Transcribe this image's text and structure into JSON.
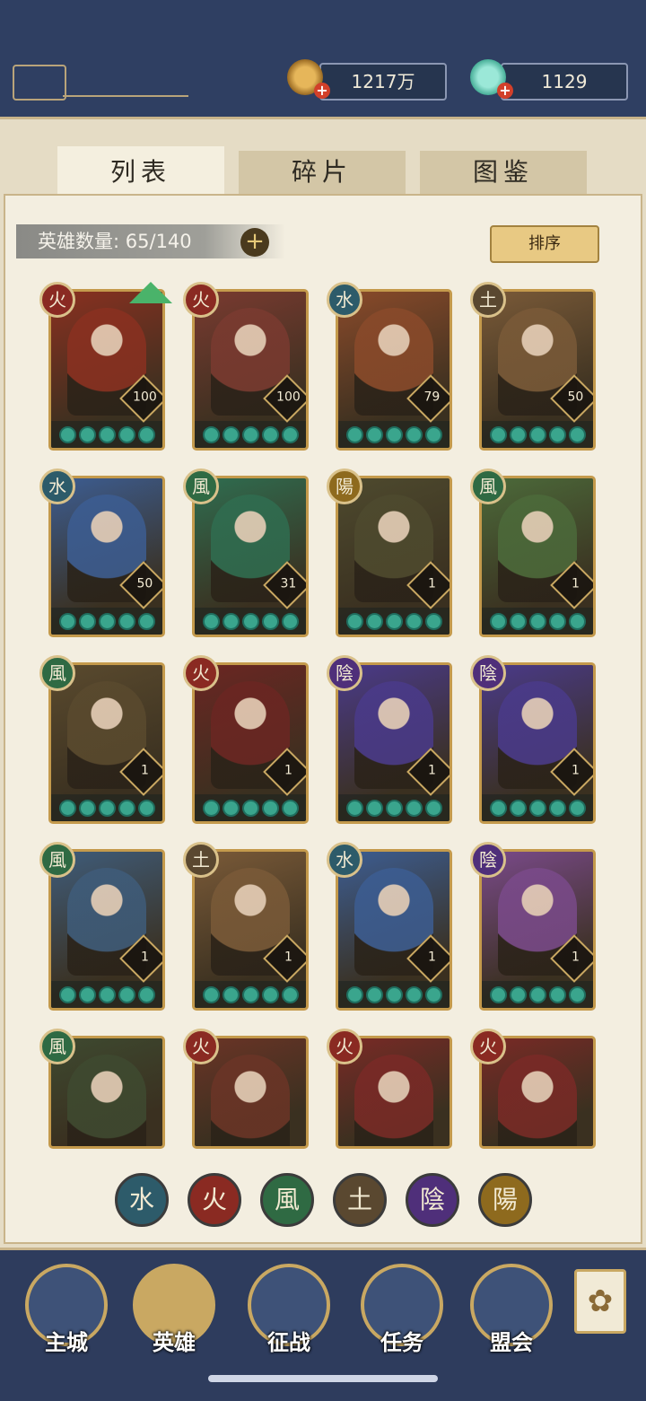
{
  "resources": {
    "coins": "1217万",
    "gems": "1129",
    "coin_icon": "coin-icon",
    "gem_icon": "jade-icon"
  },
  "tabs": [
    {
      "label": "列表",
      "active": true
    },
    {
      "label": "碎片",
      "active": false
    },
    {
      "label": "图鉴",
      "active": false
    }
  ],
  "hero_count": {
    "label": "英雄数量:",
    "value": "65/140"
  },
  "sort_label": "排序",
  "elements": {
    "water": {
      "glyph": "水",
      "color": "#2d5b6a"
    },
    "fire": {
      "glyph": "火",
      "color": "#8a2a22"
    },
    "wind": {
      "glyph": "風",
      "color": "#2f6a43"
    },
    "earth": {
      "glyph": "土",
      "color": "#5a4830"
    },
    "yin": {
      "glyph": "陰",
      "color": "#4f2f7a"
    },
    "yang": {
      "glyph": "陽",
      "color": "#8e6a1e"
    }
  },
  "heroes": [
    {
      "element": "fire",
      "level": "100",
      "bg": "#8a3020",
      "upgrade": true
    },
    {
      "element": "fire",
      "level": "100",
      "bg": "#7a3a30"
    },
    {
      "element": "water",
      "level": "79",
      "bg": "#8a4a2a"
    },
    {
      "element": "earth",
      "level": "50",
      "bg": "#7a5a38"
    },
    {
      "element": "water",
      "level": "50",
      "bg": "#3c5d92"
    },
    {
      "element": "wind",
      "level": "31",
      "bg": "#2f6d50"
    },
    {
      "element": "yang",
      "level": "1",
      "bg": "#4e4a2e"
    },
    {
      "element": "wind",
      "level": "1",
      "bg": "#4c6a3a"
    },
    {
      "element": "wind",
      "level": "1",
      "bg": "#5a4a2e"
    },
    {
      "element": "fire",
      "level": "1",
      "bg": "#6b2622"
    },
    {
      "element": "yin",
      "level": "1",
      "bg": "#4a3a8a"
    },
    {
      "element": "yin",
      "level": "1",
      "bg": "#4a3a8a"
    },
    {
      "element": "wind",
      "level": "1",
      "bg": "#3f5c7a"
    },
    {
      "element": "earth",
      "level": "1",
      "bg": "#7a5a38"
    },
    {
      "element": "water",
      "level": "1",
      "bg": "#3c5d92"
    },
    {
      "element": "yin",
      "level": "1",
      "bg": "#7a4a8a"
    },
    {
      "element": "wind",
      "level": "",
      "bg": "#3e4a30"
    },
    {
      "element": "fire",
      "level": "",
      "bg": "#6b3426"
    },
    {
      "element": "fire",
      "level": "",
      "bg": "#7a2a26"
    },
    {
      "element": "fire",
      "level": "",
      "bg": "#7a2a26"
    }
  ],
  "filters": [
    "water",
    "fire",
    "wind",
    "earth",
    "yin",
    "yang"
  ],
  "nav": [
    {
      "label": "主城",
      "icon": "castle-icon"
    },
    {
      "label": "英雄",
      "icon": "hero-icon"
    },
    {
      "label": "征战",
      "icon": "battle-icon"
    },
    {
      "label": "任务",
      "icon": "scroll-icon"
    },
    {
      "label": "盟会",
      "icon": "guild-icon"
    }
  ],
  "menu_icon": "menu-icon"
}
